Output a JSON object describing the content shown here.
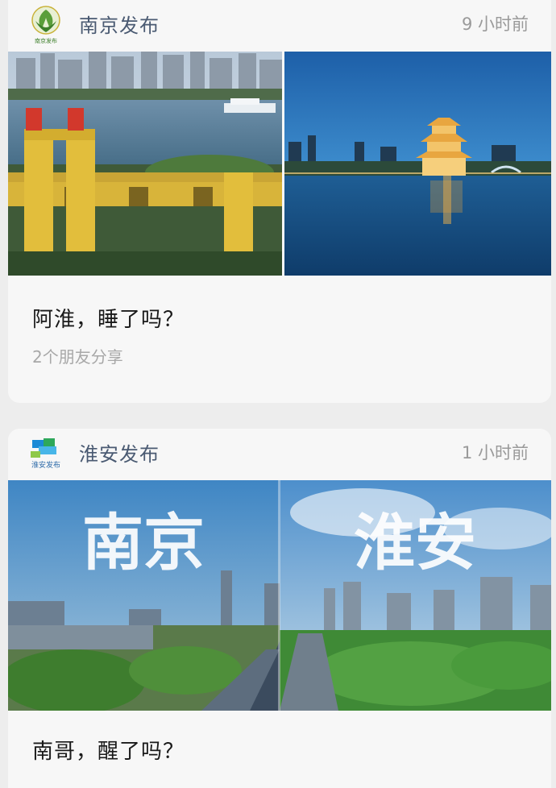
{
  "posts": [
    {
      "account_name": "南京发布",
      "logo_text": "南京发布",
      "time": "9 小时前",
      "title": "阿淮，睡了吗？",
      "meta": "2个朋友分享",
      "image": {
        "left_scene": "nanjing-yangtze-bridge",
        "right_scene": "huaian-pavilion-night"
      }
    },
    {
      "account_name": "淮安发布",
      "logo_text": "淮安发布",
      "time": "1 小时前",
      "title": "南哥，醒了吗？",
      "image": {
        "left_text": "南京",
        "right_text": "淮安"
      }
    }
  ],
  "colors": {
    "background": "#ededed",
    "card": "#f7f7f7",
    "account_name": "#4a5a72",
    "secondary": "#9a9a9a"
  }
}
